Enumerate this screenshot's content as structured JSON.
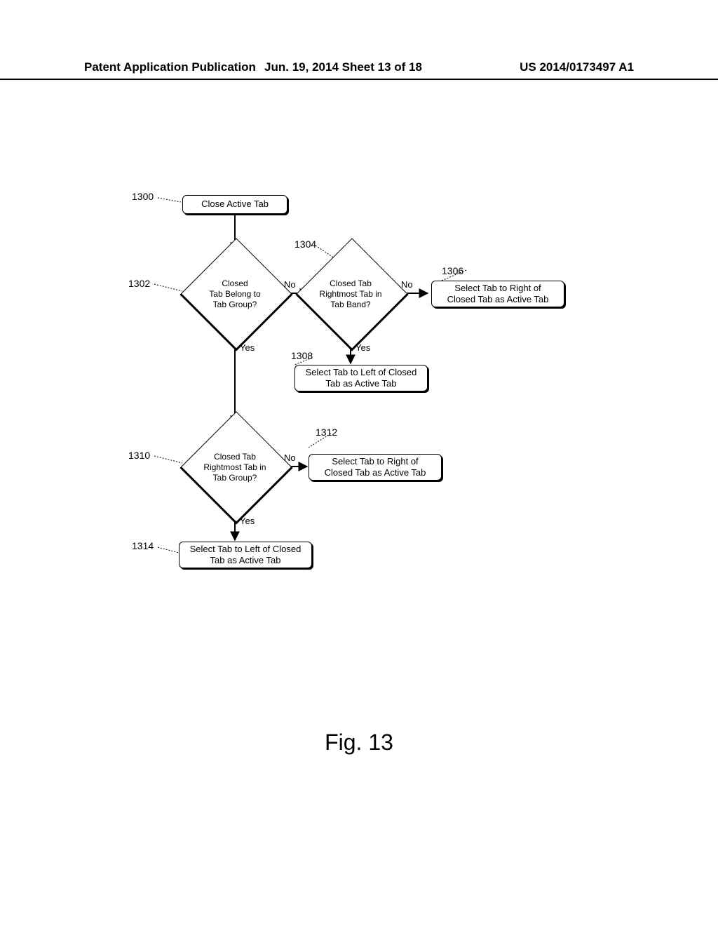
{
  "header": {
    "left": "Patent Application Publication",
    "mid": "Jun. 19, 2014  Sheet 13 of 18",
    "right": "US 2014/0173497 A1"
  },
  "figure_caption": "Fig. 13",
  "refs": {
    "r1300": "1300",
    "r1302": "1302",
    "r1304": "1304",
    "r1306": "1306",
    "r1308": "1308",
    "r1310": "1310",
    "r1312": "1312",
    "r1314": "1314"
  },
  "nodes": {
    "n1300": "Close Active Tab",
    "n1302": "Closed\nTab Belong to\nTab Group?",
    "n1304": "Closed Tab\nRightmost Tab in\nTab Band?",
    "n1306": "Select Tab to Right of\nClosed Tab as Active Tab",
    "n1308": "Select Tab to Left of Closed\nTab as Active Tab",
    "n1310": "Closed Tab\nRightmost Tab in\nTab Group?",
    "n1312": "Select Tab to Right of\nClosed Tab as Active Tab",
    "n1314": "Select Tab to Left of Closed\nTab as Active Tab"
  },
  "edges": {
    "no": "No",
    "yes": "Yes"
  }
}
